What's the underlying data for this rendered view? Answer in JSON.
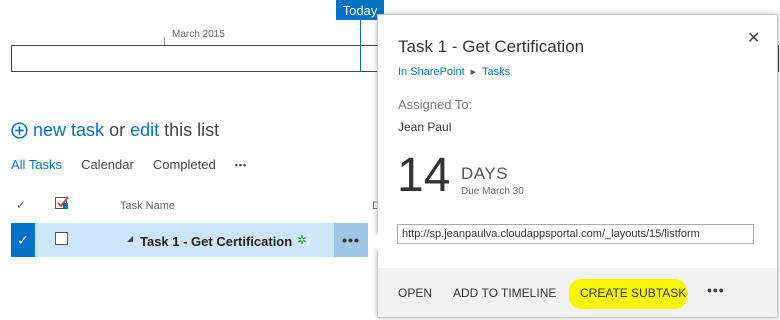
{
  "timeline": {
    "month_label": "March 2015",
    "today_label": "Today"
  },
  "list_actions": {
    "new_task_label": "new task",
    "or_text": "or",
    "edit_label": "edit",
    "this_list_text": "this list"
  },
  "views": {
    "tabs": [
      {
        "label": "All Tasks",
        "active": true
      },
      {
        "label": "Calendar",
        "active": false
      },
      {
        "label": "Completed",
        "active": false
      }
    ],
    "more_label": "•••"
  },
  "list": {
    "header": {
      "check_glyph": "✓",
      "task_name": "Task Name",
      "next_col_partial": "D"
    },
    "rows": [
      {
        "title": "Task 1 - Get Certification",
        "selected": true,
        "new_badge": "✲"
      }
    ],
    "ellipsis_label": "•••"
  },
  "callout": {
    "title": "Task 1 - Get Certification",
    "close_glyph": "✕",
    "breadcrumb": [
      "In SharePoint",
      "Tasks"
    ],
    "assigned_label": "Assigned To:",
    "assigned_value": "Jean Paul",
    "days_value": "14",
    "days_label": "DAYS",
    "due_label": "Due March 30",
    "url": "http://sp.jeanpaulva.cloudappsportal.com/_layouts/15/listform",
    "actions": {
      "open": "OPEN",
      "add_to_timeline": "ADD TO TIMELINE",
      "create_subtask": "CREATE SUBTASK",
      "more": "•••"
    }
  },
  "colors": {
    "accent": "#0072c6",
    "selected_row": "#cde6f7",
    "highlight": "#f6f500"
  }
}
